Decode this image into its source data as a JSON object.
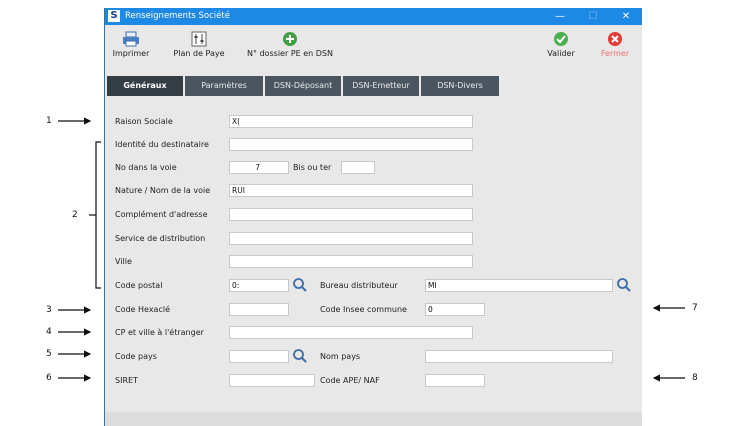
{
  "window": {
    "title": "Renseignements Société",
    "logo": "S",
    "minimize": "—",
    "maximize": "☐",
    "close": "✕"
  },
  "toolbar": {
    "print": "Imprimer",
    "payroll_plan": "Plan de Paye",
    "dossier_pe": "N° dossier PE en DSN",
    "validate": "Valider",
    "close": "Fermer",
    "colors": {
      "validate": "#4caf50",
      "close": "#e53935",
      "add": "#43a047"
    }
  },
  "tabs": [
    "Généraux",
    "Paramètres",
    "DSN-Déposant",
    "DSN-Emetteur",
    "DSN-Divers"
  ],
  "form": {
    "raison_sociale": {
      "label": "Raison Sociale",
      "value": "X("
    },
    "identite": {
      "label": "Identité du destinataire",
      "value": ""
    },
    "no_voie": {
      "label": "No dans la voie",
      "value": "7"
    },
    "bis_ter": {
      "label": "Bis ou ter",
      "value": ""
    },
    "nature_nom_voie": {
      "label": "Nature / Nom de la voie",
      "value": "RUI"
    },
    "complement": {
      "label": "Complément d'adresse",
      "value": ""
    },
    "service": {
      "label": "Service de distribution",
      "value": ""
    },
    "ville": {
      "label": "Ville",
      "value": ""
    },
    "code_postal": {
      "label": "Code postal",
      "value": "0:"
    },
    "bureau": {
      "label": "Bureau distributeur",
      "value": "MI"
    },
    "hexacle": {
      "label": "Code Hexaclé",
      "value": ""
    },
    "insee": {
      "label": "Code Insee commune",
      "value": "0"
    },
    "cp_etranger": {
      "label": "CP et ville à l'étranger",
      "value": ""
    },
    "code_pays": {
      "label": "Code pays",
      "value": ""
    },
    "nom_pays": {
      "label": "Nom pays",
      "value": ""
    },
    "siret": {
      "label": "SIRET",
      "value": ""
    },
    "ape": {
      "label": "Code APE/ NAF",
      "value": ""
    }
  },
  "callouts": {
    "n1": "1",
    "n2": "2",
    "n3": "3",
    "n4": "4",
    "n5": "5",
    "n6": "6",
    "n7": "7",
    "n8": "8"
  }
}
